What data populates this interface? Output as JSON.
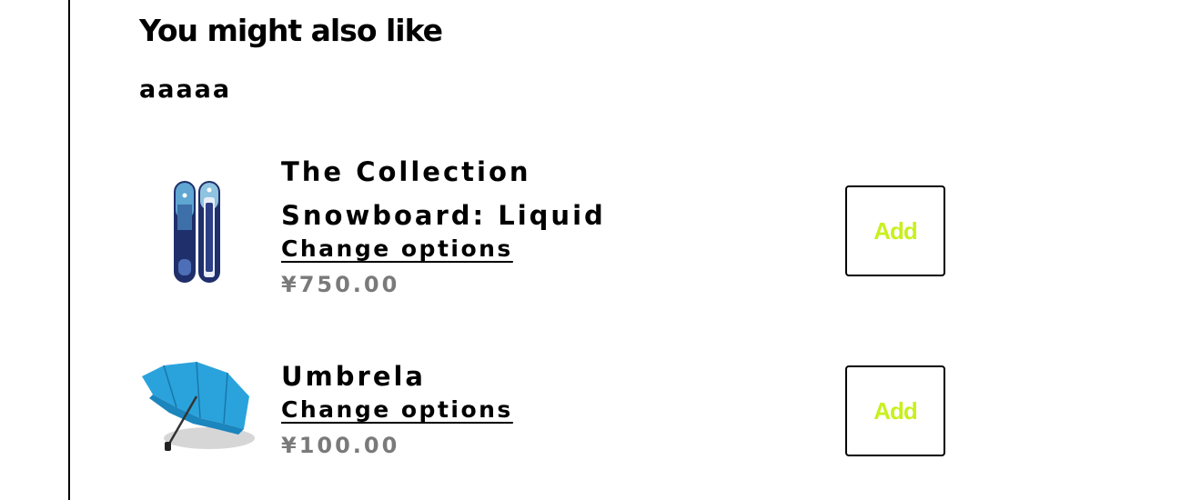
{
  "section": {
    "title": "You might also like",
    "subtitle": "aaaaa"
  },
  "products": [
    {
      "name": "The Collection Snowboard: Liquid",
      "change_options_label": "Change options",
      "price": "¥750.00",
      "image": "snowboard-liquid-image",
      "add_label": "Add"
    },
    {
      "name": "Umbrela",
      "change_options_label": "Change options",
      "price": "¥100.00",
      "image": "blue-umbrella-image",
      "add_label": "Add"
    }
  ],
  "colors": {
    "add_text": "#c8f01e",
    "price_text": "#7a7a7a",
    "snowboard_dark": "#1f2f6b",
    "snowboard_light": "#5fa6d2",
    "umbrella_blue": "#2aa3dc"
  }
}
